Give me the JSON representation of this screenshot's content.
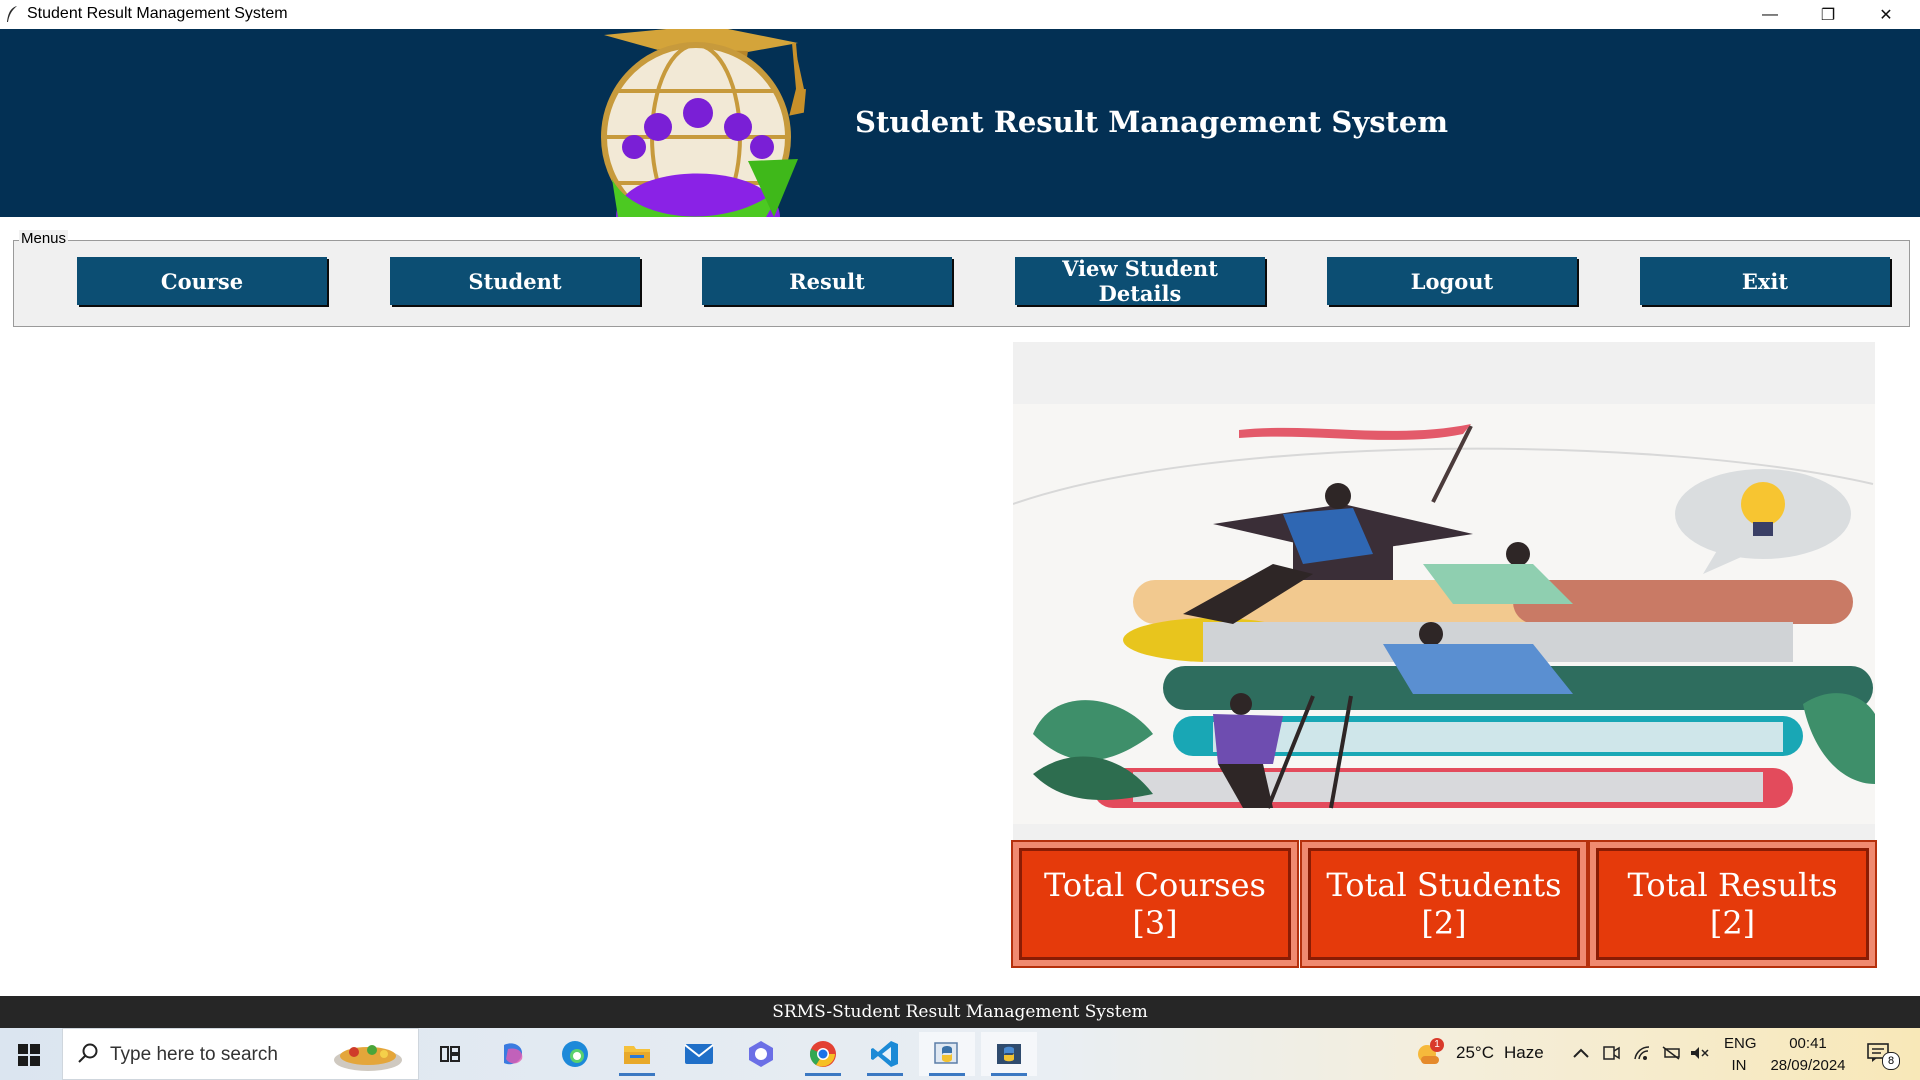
{
  "window": {
    "title": "Student Result Management System",
    "controls": {
      "minimize": "—",
      "maximize": "❐",
      "close": "✕"
    }
  },
  "header": {
    "title": "Student Result Management System"
  },
  "menus": {
    "legend": "Menus",
    "buttons": [
      "Course",
      "Student",
      "Result",
      "View Student Details",
      "Logout",
      "Exit"
    ]
  },
  "stats": {
    "courses": {
      "label": "Total Courses",
      "value": "[3]"
    },
    "students": {
      "label": "Total Students",
      "value": "[2]"
    },
    "results": {
      "label": "Total Results",
      "value": "[2]"
    }
  },
  "footer": {
    "text": "SRMS-Student Result Management System"
  },
  "taskbar": {
    "search_placeholder": "Type here to search",
    "weather": {
      "temp": "25°C",
      "condition": "Haze",
      "badge": "1"
    },
    "language": {
      "line1": "ENG",
      "line2": "IN"
    },
    "clock": {
      "time": "00:41",
      "date": "28/09/2024"
    },
    "notifications_count": "8",
    "apps": [
      "task-view",
      "copilot",
      "edge",
      "file-explorer",
      "mail",
      "copilot-alt",
      "chrome",
      "vscode",
      "python-idle",
      "python-app"
    ]
  },
  "colors": {
    "header_bg": "#033054",
    "menu_button_bg": "#0c4e73",
    "stat_bg": "#e53a0b",
    "footer_bg": "#262626"
  }
}
